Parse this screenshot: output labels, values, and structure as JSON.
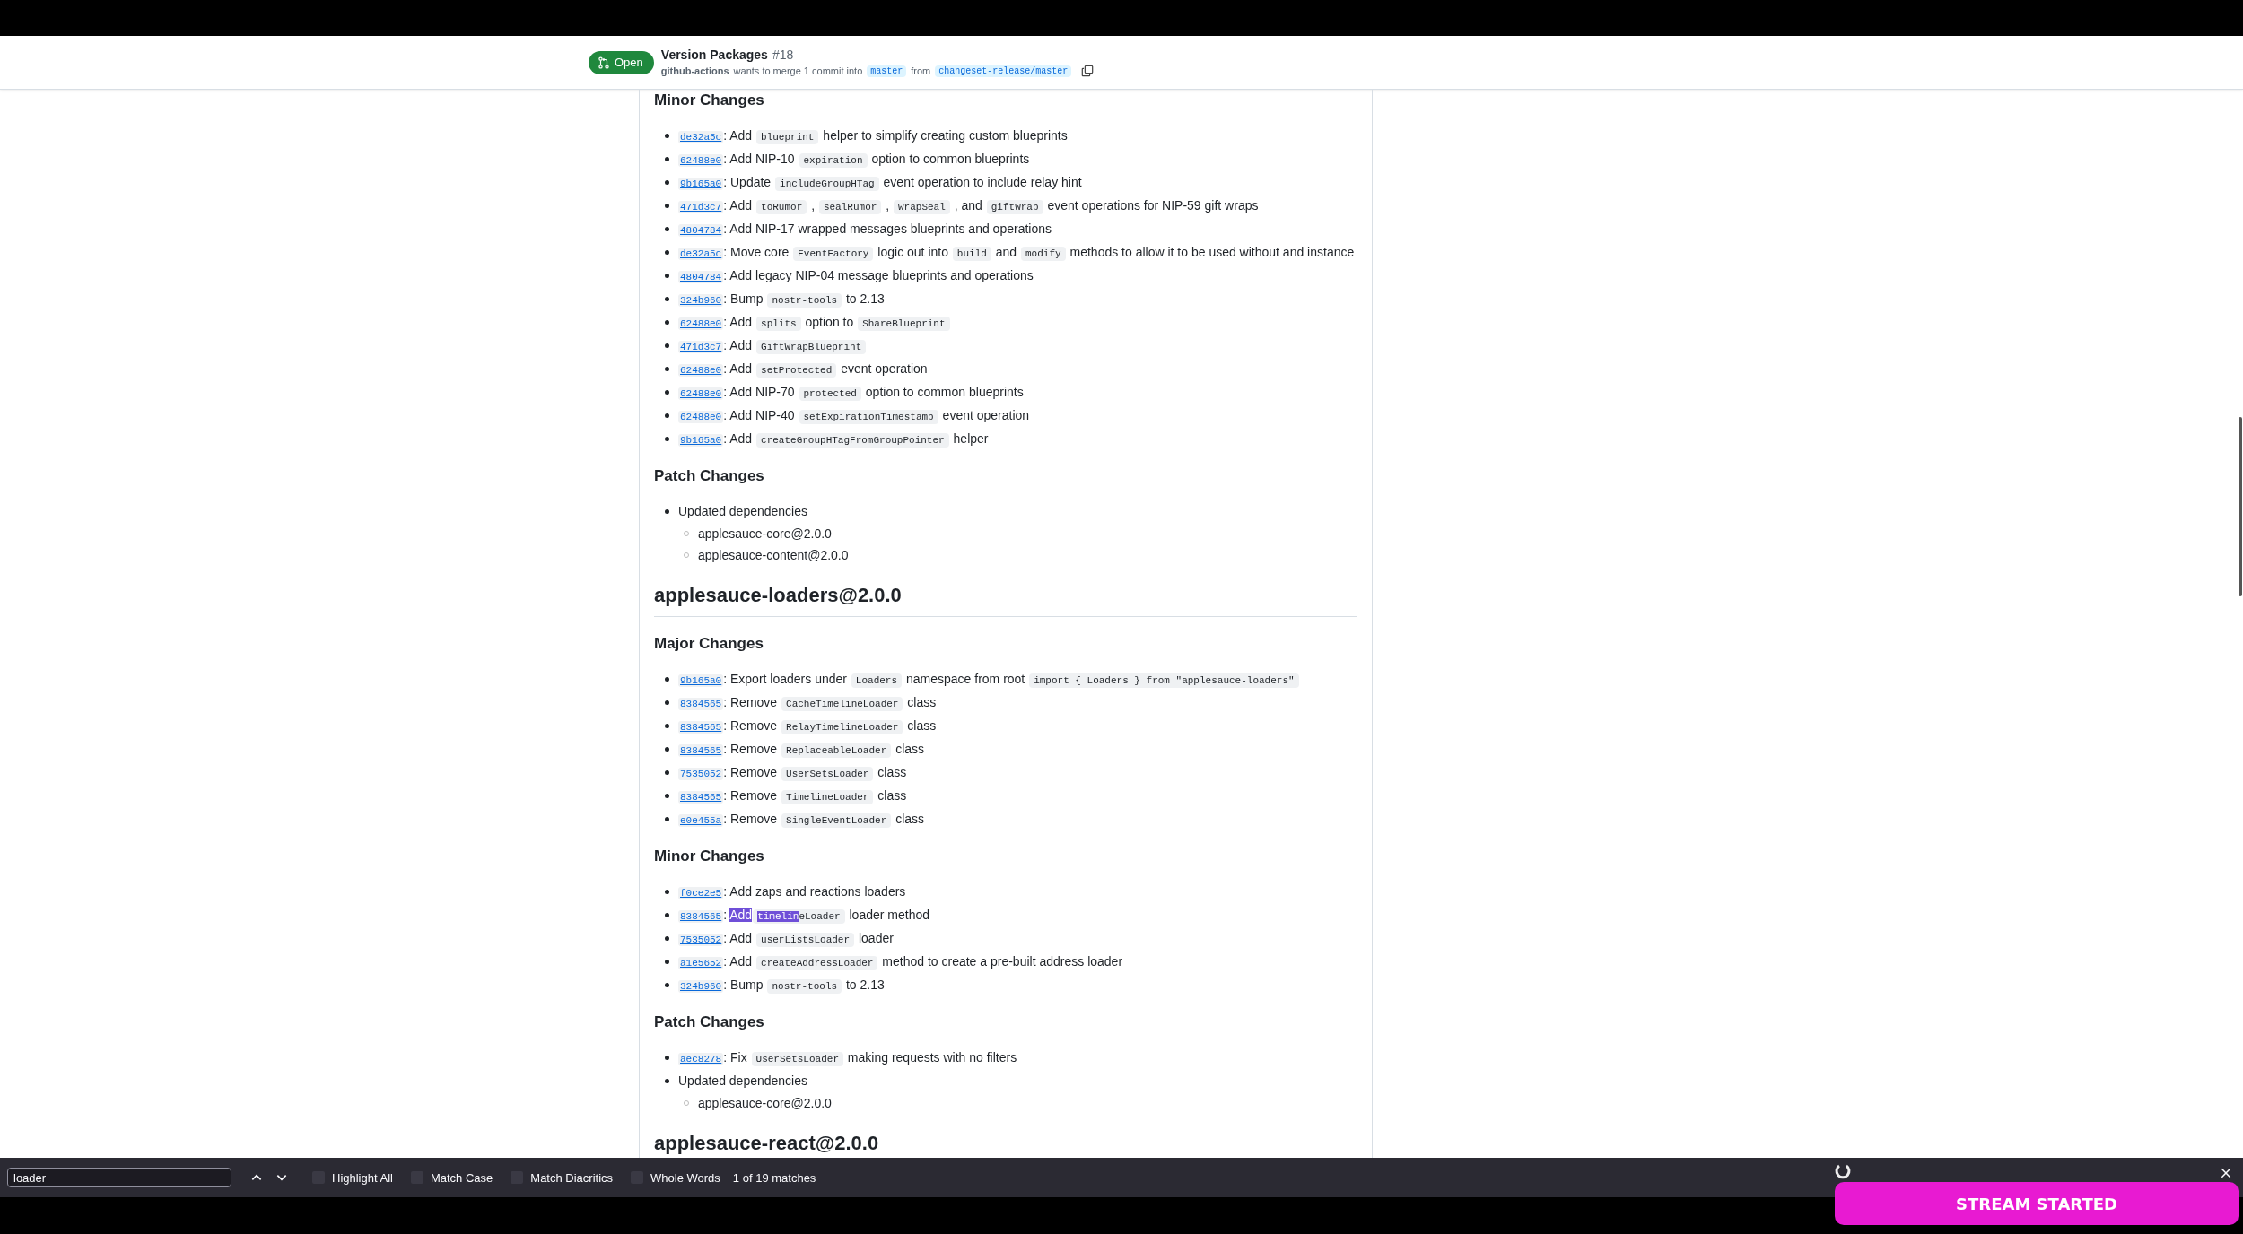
{
  "pull_request": {
    "state": "Open",
    "title": "Version Packages",
    "number": "#18",
    "author": "github-actions",
    "summary_1": "wants to merge 1 commit into",
    "base_branch": "master",
    "summary_2": "from",
    "head_branch": "changeset-release/master"
  },
  "content": [
    {
      "kind": "h3",
      "text": "Minor Changes"
    },
    {
      "kind": "list",
      "items": [
        {
          "commit": "de32a5c",
          "segments": [
            {
              "kind": "text",
              "text": ": Add "
            },
            {
              "kind": "code",
              "text": "blueprint"
            },
            {
              "kind": "text",
              "text": " helper to simplify creating custom blueprints"
            }
          ]
        },
        {
          "commit": "62488e0",
          "segments": [
            {
              "kind": "text",
              "text": ": Add NIP-10 "
            },
            {
              "kind": "code",
              "text": "expiration"
            },
            {
              "kind": "text",
              "text": " option to common blueprints"
            }
          ]
        },
        {
          "commit": "9b165a0",
          "segments": [
            {
              "kind": "text",
              "text": ": Update "
            },
            {
              "kind": "code",
              "text": "includeGroupHTag"
            },
            {
              "kind": "text",
              "text": " event operation to include relay hint"
            }
          ]
        },
        {
          "commit": "471d3c7",
          "segments": [
            {
              "kind": "text",
              "text": ": Add "
            },
            {
              "kind": "code",
              "text": "toRumor"
            },
            {
              "kind": "text",
              "text": " , "
            },
            {
              "kind": "code",
              "text": "sealRumor"
            },
            {
              "kind": "text",
              "text": " , "
            },
            {
              "kind": "code",
              "text": "wrapSeal"
            },
            {
              "kind": "text",
              "text": " , and "
            },
            {
              "kind": "code",
              "text": "giftWrap"
            },
            {
              "kind": "text",
              "text": " event operations for NIP-59 gift wraps"
            }
          ]
        },
        {
          "commit": "4804784",
          "segments": [
            {
              "kind": "text",
              "text": ": Add NIP-17 wrapped messages blueprints and operations"
            }
          ]
        },
        {
          "commit": "de32a5c",
          "segments": [
            {
              "kind": "text",
              "text": ": Move core "
            },
            {
              "kind": "code",
              "text": "EventFactory"
            },
            {
              "kind": "text",
              "text": " logic out into "
            },
            {
              "kind": "code",
              "text": "build"
            },
            {
              "kind": "text",
              "text": " and "
            },
            {
              "kind": "code",
              "text": "modify"
            },
            {
              "kind": "text",
              "text": " methods to allow it to be used without and instance"
            }
          ]
        },
        {
          "commit": "4804784",
          "segments": [
            {
              "kind": "text",
              "text": ": Add legacy NIP-04 message blueprints and operations"
            }
          ]
        },
        {
          "commit": "324b960",
          "segments": [
            {
              "kind": "text",
              "text": ": Bump "
            },
            {
              "kind": "code",
              "text": "nostr-tools"
            },
            {
              "kind": "text",
              "text": " to 2.13"
            }
          ]
        },
        {
          "commit": "62488e0",
          "segments": [
            {
              "kind": "text",
              "text": ": Add "
            },
            {
              "kind": "code",
              "text": "splits"
            },
            {
              "kind": "text",
              "text": " option to "
            },
            {
              "kind": "code",
              "text": "ShareBlueprint"
            }
          ]
        },
        {
          "commit": "471d3c7",
          "segments": [
            {
              "kind": "text",
              "text": ": Add "
            },
            {
              "kind": "code",
              "text": "GiftWrapBlueprint"
            }
          ]
        },
        {
          "commit": "62488e0",
          "segments": [
            {
              "kind": "text",
              "text": ": Add "
            },
            {
              "kind": "code",
              "text": "setProtected"
            },
            {
              "kind": "text",
              "text": " event operation"
            }
          ]
        },
        {
          "commit": "62488e0",
          "segments": [
            {
              "kind": "text",
              "text": ": Add NIP-70 "
            },
            {
              "kind": "code",
              "text": "protected"
            },
            {
              "kind": "text",
              "text": " option to common blueprints"
            }
          ]
        },
        {
          "commit": "62488e0",
          "segments": [
            {
              "kind": "text",
              "text": ": Add NIP-40 "
            },
            {
              "kind": "code",
              "text": "setExpirationTimestamp"
            },
            {
              "kind": "text",
              "text": " event operation"
            }
          ]
        },
        {
          "commit": "9b165a0",
          "segments": [
            {
              "kind": "text",
              "text": ": Add "
            },
            {
              "kind": "code",
              "text": "createGroupHTagFromGroupPointer"
            },
            {
              "kind": "text",
              "text": " helper"
            }
          ]
        }
      ]
    },
    {
      "kind": "h3",
      "text": "Patch Changes"
    },
    {
      "kind": "list",
      "items": [
        {
          "segments": [
            {
              "kind": "text",
              "text": "Updated dependencies"
            }
          ],
          "children": [
            {
              "text": "applesauce-core@2.0.0"
            },
            {
              "text": "applesauce-content@2.0.0"
            }
          ]
        }
      ]
    },
    {
      "kind": "h2",
      "text": "applesauce-loaders@2.0.0"
    },
    {
      "kind": "h3",
      "text": "Major Changes"
    },
    {
      "kind": "list",
      "items": [
        {
          "commit": "9b165a0",
          "segments": [
            {
              "kind": "text",
              "text": ": Export loaders under "
            },
            {
              "kind": "code",
              "text": "Loaders"
            },
            {
              "kind": "text",
              "text": " namespace from root "
            },
            {
              "kind": "code",
              "text": "import { Loaders } from \"applesauce-loaders\""
            }
          ]
        },
        {
          "commit": "8384565",
          "segments": [
            {
              "kind": "text",
              "text": ": Remove "
            },
            {
              "kind": "code",
              "text": "CacheTimelineLoader"
            },
            {
              "kind": "text",
              "text": " class"
            }
          ]
        },
        {
          "commit": "8384565",
          "segments": [
            {
              "kind": "text",
              "text": ": Remove "
            },
            {
              "kind": "code",
              "text": "RelayTimelineLoader"
            },
            {
              "kind": "text",
              "text": " class"
            }
          ]
        },
        {
          "commit": "8384565",
          "segments": [
            {
              "kind": "text",
              "text": ": Remove "
            },
            {
              "kind": "code",
              "text": "ReplaceableLoader"
            },
            {
              "kind": "text",
              "text": " class"
            }
          ]
        },
        {
          "commit": "7535052",
          "segments": [
            {
              "kind": "text",
              "text": ": Remove "
            },
            {
              "kind": "code",
              "text": "UserSetsLoader"
            },
            {
              "kind": "text",
              "text": " class"
            }
          ]
        },
        {
          "commit": "8384565",
          "segments": [
            {
              "kind": "text",
              "text": ": Remove "
            },
            {
              "kind": "code",
              "text": "TimelineLoader"
            },
            {
              "kind": "text",
              "text": " class"
            }
          ]
        },
        {
          "commit": "e0e455a",
          "segments": [
            {
              "kind": "text",
              "text": ": Remove "
            },
            {
              "kind": "code",
              "text": "SingleEventLoader"
            },
            {
              "kind": "text",
              "text": " class"
            }
          ]
        }
      ]
    },
    {
      "kind": "h3",
      "text": "Minor Changes"
    },
    {
      "kind": "list",
      "items": [
        {
          "commit": "f0ce2e5",
          "segments": [
            {
              "kind": "text",
              "text": ": Add zaps and reactions loaders"
            }
          ]
        },
        {
          "commit": "8384565",
          "segments": [
            {
              "kind": "text",
              "text": ": "
            },
            {
              "kind": "selected_text",
              "text": "Add"
            },
            {
              "kind": "space"
            },
            {
              "kind": "code",
              "pieces": [
                {
                  "text": "timelin",
                  "highlighted": true
                },
                {
                  "text": "eLoader",
                  "highlighted": false
                }
              ]
            },
            {
              "kind": "text",
              "text": " loader method"
            }
          ]
        },
        {
          "commit": "7535052",
          "segments": [
            {
              "kind": "text",
              "text": ": Add "
            },
            {
              "kind": "code",
              "text": "userListsLoader"
            },
            {
              "kind": "text",
              "text": " loader"
            }
          ]
        },
        {
          "commit": "a1e5652",
          "segments": [
            {
              "kind": "text",
              "text": ": Add "
            },
            {
              "kind": "code",
              "text": "createAddressLoader"
            },
            {
              "kind": "text",
              "text": " method to create a pre-built address loader"
            }
          ]
        },
        {
          "commit": "324b960",
          "segments": [
            {
              "kind": "text",
              "text": ": Bump "
            },
            {
              "kind": "code",
              "text": "nostr-tools"
            },
            {
              "kind": "text",
              "text": " to 2.13"
            }
          ]
        }
      ]
    },
    {
      "kind": "h3",
      "text": "Patch Changes"
    },
    {
      "kind": "list",
      "items": [
        {
          "commit": "aec8278",
          "segments": [
            {
              "kind": "text",
              "text": ": Fix "
            },
            {
              "kind": "code",
              "text": "UserSetsLoader"
            },
            {
              "kind": "text",
              "text": " making requests with no filters"
            }
          ]
        },
        {
          "segments": [
            {
              "kind": "text",
              "text": "Updated dependencies"
            }
          ],
          "children": [
            {
              "text": "applesauce-core@2.0.0"
            }
          ]
        }
      ]
    },
    {
      "kind": "h2",
      "text": "applesauce-react@2.0.0"
    }
  ],
  "find_bar": {
    "value": "loader",
    "options": [
      {
        "label": "Highlight All",
        "checked": false
      },
      {
        "label": "Match Case",
        "checked": false
      },
      {
        "label": "Match Diacritics",
        "checked": false
      },
      {
        "label": "Whole Words",
        "checked": false
      }
    ],
    "match_count": "1 of 19 matches"
  },
  "toast": {
    "text": "STREAM STARTED"
  }
}
